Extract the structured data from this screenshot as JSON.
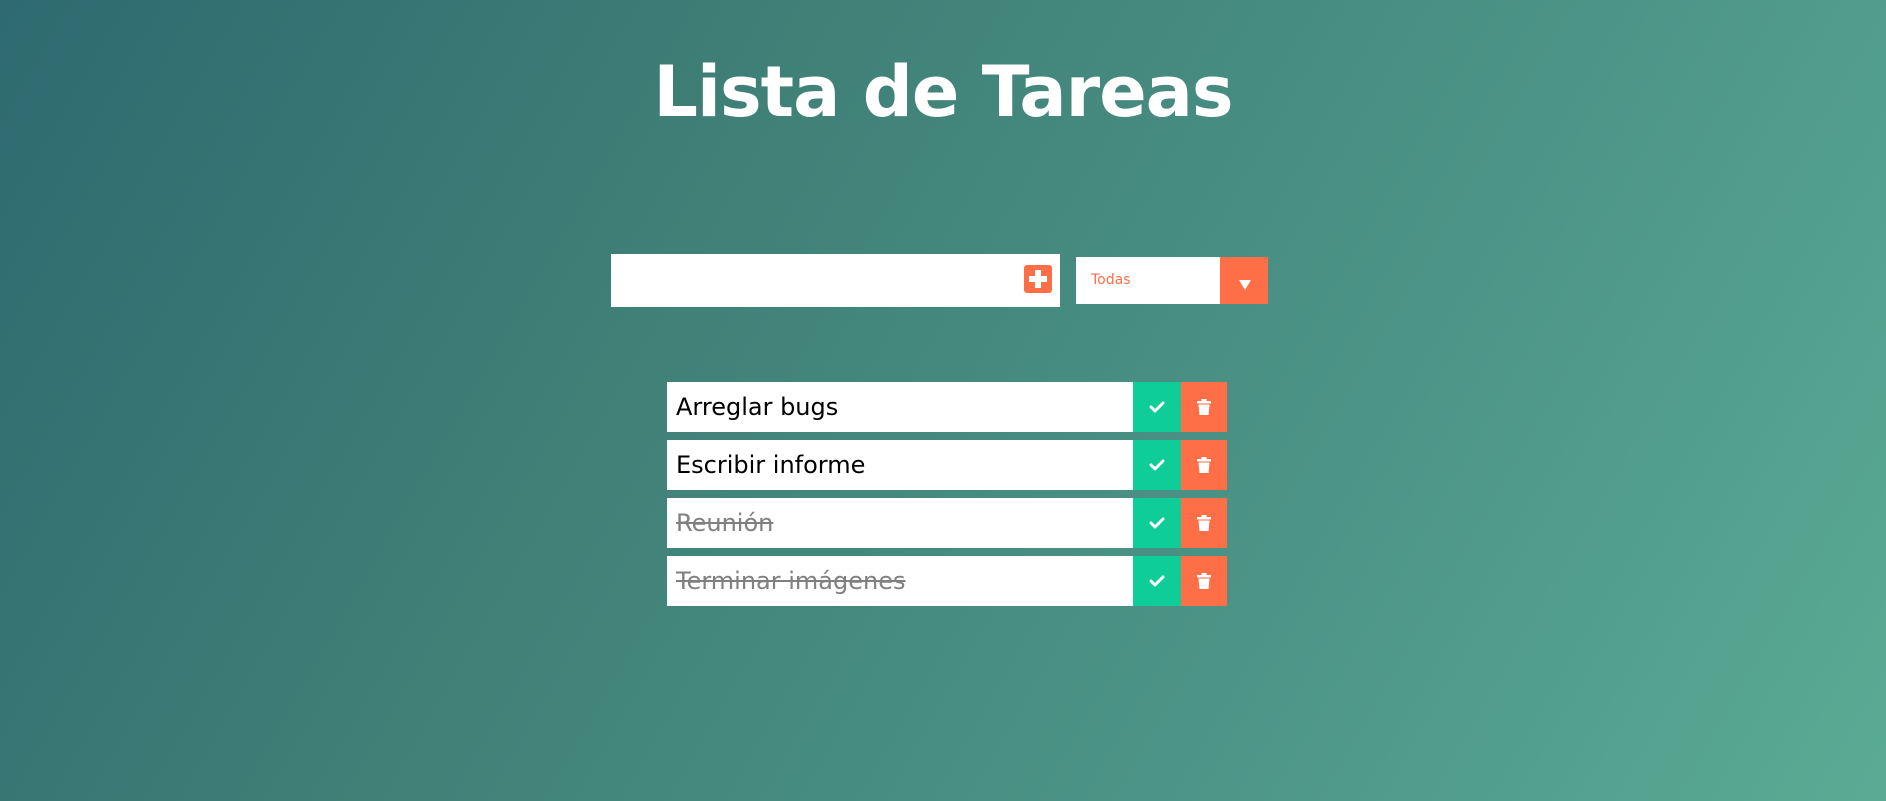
{
  "header": {
    "title": "Lista de Tareas"
  },
  "form": {
    "input_value": "",
    "input_placeholder": "",
    "add_icon": "plus-icon",
    "filter": {
      "selected": "Todas",
      "arrow_icon": "caret-down-icon"
    }
  },
  "todos": [
    {
      "text": "Arreglar bugs",
      "completed": false
    },
    {
      "text": "Escribir informe",
      "completed": false
    },
    {
      "text": "Reunión",
      "completed": true
    },
    {
      "text": "Terminar imágenes",
      "completed": true
    }
  ],
  "icons": {
    "complete": "check-icon",
    "delete": "trash-icon"
  },
  "colors": {
    "accent": "#ff6f47",
    "complete": "#0fcd98",
    "gradient_start": "#2e6a70",
    "gradient_end": "#5aab94"
  }
}
